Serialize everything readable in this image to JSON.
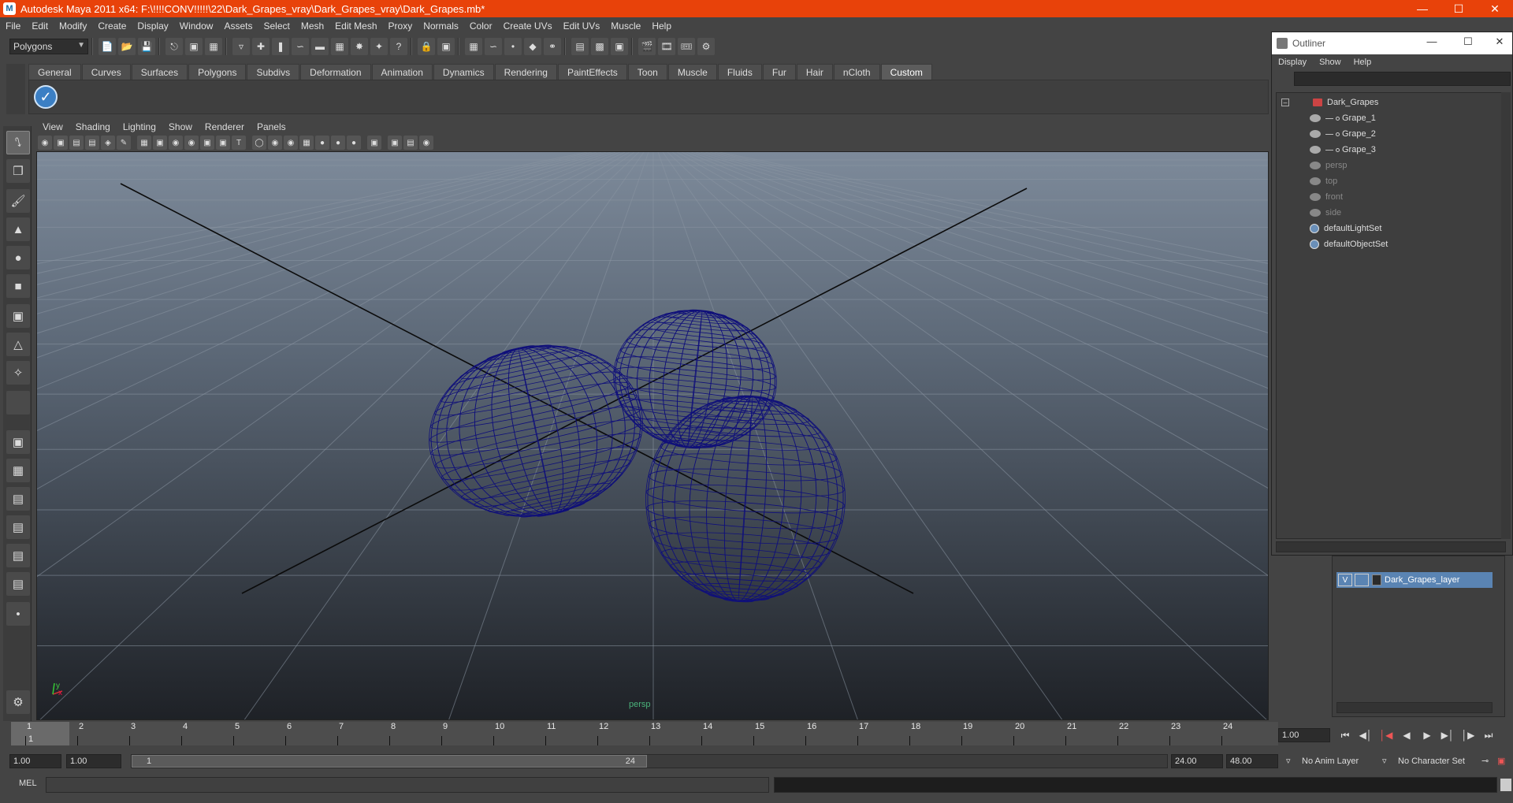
{
  "window": {
    "title": "Autodesk Maya 2011 x64: F:\\!!!!CONV!!!!!\\22\\Dark_Grapes_vray\\Dark_Grapes_vray\\Dark_Grapes.mb*"
  },
  "menubar": [
    "File",
    "Edit",
    "Modify",
    "Create",
    "Display",
    "Window",
    "Assets",
    "Select",
    "Mesh",
    "Edit Mesh",
    "Proxy",
    "Normals",
    "Color",
    "Create UVs",
    "Edit UVs",
    "Muscle",
    "Help"
  ],
  "statusline": {
    "mode": "Polygons"
  },
  "shelf": {
    "tabs": [
      "General",
      "Curves",
      "Surfaces",
      "Polygons",
      "Subdivs",
      "Deformation",
      "Animation",
      "Dynamics",
      "Rendering",
      "PaintEffects",
      "Toon",
      "Muscle",
      "Fluids",
      "Fur",
      "Hair",
      "nCloth",
      "Custom"
    ],
    "active_tab": "Custom"
  },
  "viewport": {
    "menu": [
      "View",
      "Shading",
      "Lighting",
      "Show",
      "Renderer",
      "Panels"
    ],
    "camera": "persp",
    "axis_x": "x",
    "axis_y": "y",
    "wire_color": "#10107a",
    "bg_top": "#7d8a9a",
    "bg_bottom": "#1e2126"
  },
  "outliner": {
    "title": "Outliner",
    "menu": [
      "Display",
      "Show",
      "Help"
    ],
    "items": [
      {
        "label": "Dark_Grapes",
        "dim": false
      },
      {
        "label": "Grape_1",
        "dim": false
      },
      {
        "label": "Grape_2",
        "dim": false
      },
      {
        "label": "Grape_3",
        "dim": false
      },
      {
        "label": "persp",
        "dim": true
      },
      {
        "label": "top",
        "dim": true
      },
      {
        "label": "front",
        "dim": true
      },
      {
        "label": "side",
        "dim": true
      },
      {
        "label": "defaultLightSet",
        "dim": false
      },
      {
        "label": "defaultObjectSet",
        "dim": false
      }
    ]
  },
  "layers": {
    "items": [
      {
        "visible": "V",
        "name": "Dark_Grapes_layer"
      }
    ]
  },
  "timeslider": {
    "frames": [
      "1",
      "2",
      "3",
      "4",
      "5",
      "6",
      "7",
      "8",
      "9",
      "10",
      "11",
      "12",
      "13",
      "14",
      "15",
      "16",
      "17",
      "18",
      "19",
      "20",
      "21",
      "22",
      "23",
      "24"
    ],
    "current_marker": "1",
    "current_frame": "1.00"
  },
  "rangeslider": {
    "start": "1.00",
    "playback_start": "1.00",
    "range_start_label": "1",
    "range_end_label": "24",
    "playback_end": "24.00",
    "end": "48.00",
    "anim_layer": "No Anim Layer",
    "character_set": "No Character Set"
  },
  "cmdline": {
    "label": "MEL"
  }
}
